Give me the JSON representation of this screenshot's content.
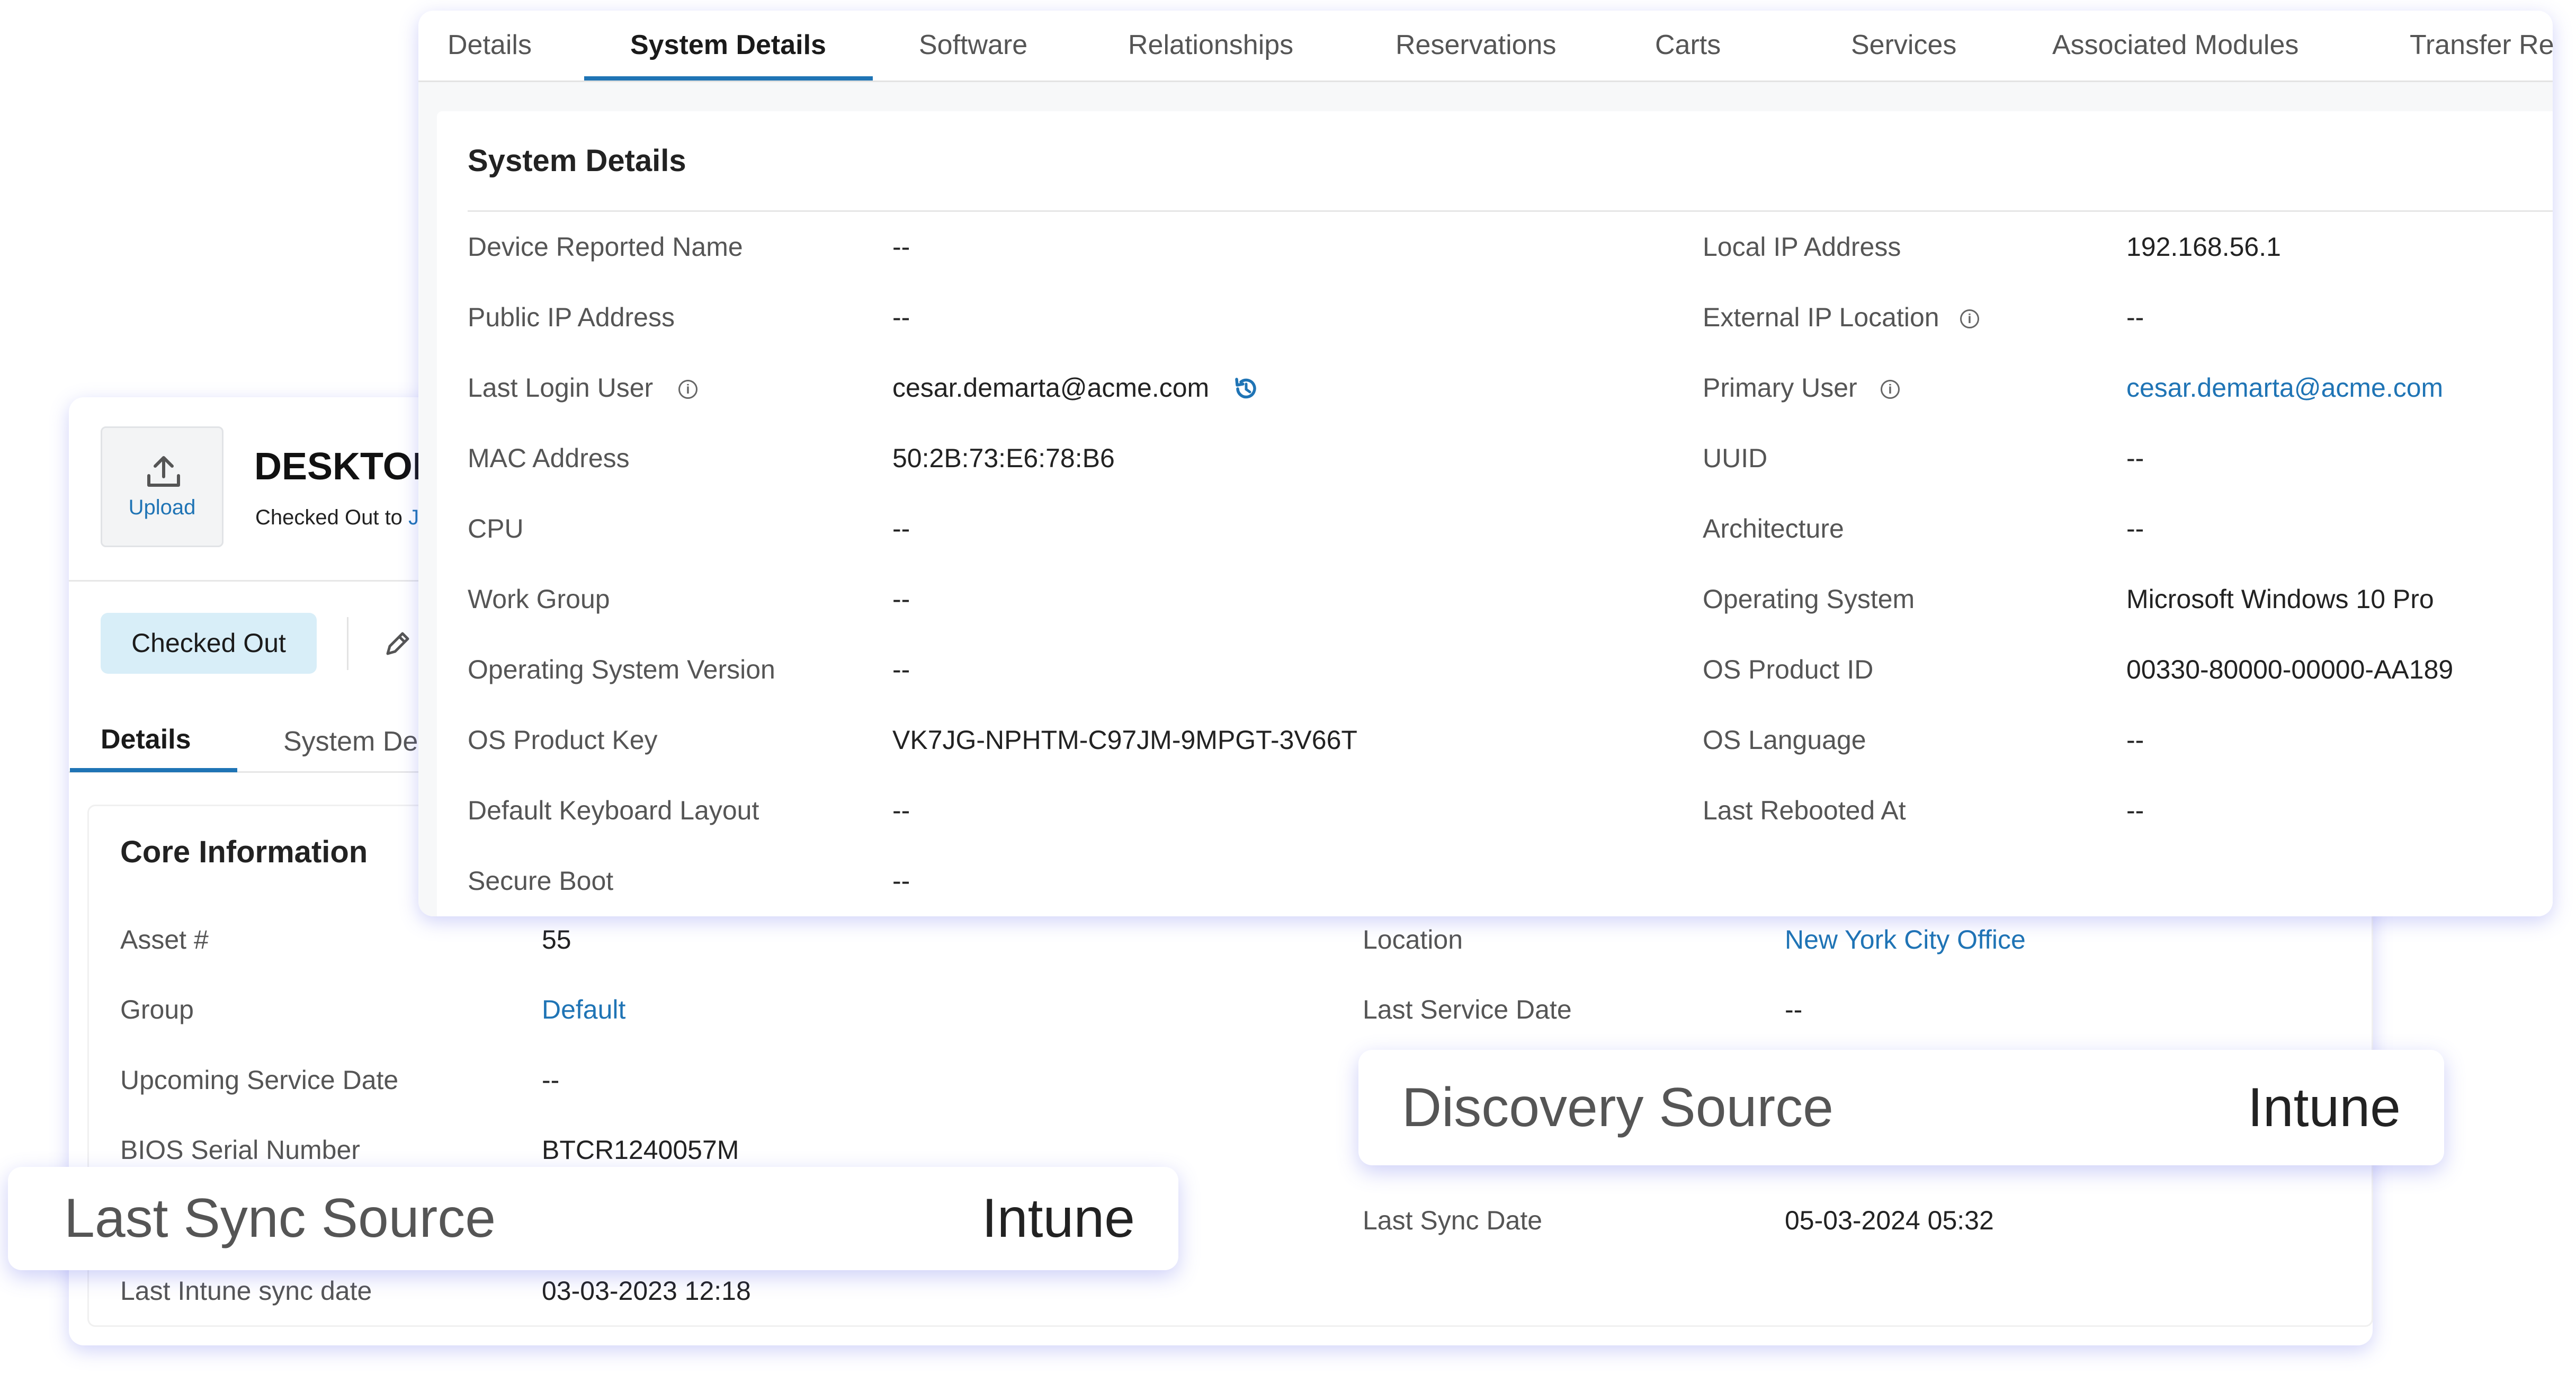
{
  "asset": {
    "upload_label": "Upload",
    "title": "DESKTOP",
    "checked_out_text": "Checked Out to",
    "checked_out_link": "J",
    "status_badge": "Checked Out",
    "tabs": [
      {
        "label": "Details"
      },
      {
        "label": "System De"
      }
    ],
    "core": {
      "title": "Core Information",
      "left_rows": [
        {
          "label": "Asset #",
          "value": "55"
        },
        {
          "label": "Group",
          "value": "Default"
        },
        {
          "label": "Upcoming Service Date",
          "value": "--"
        },
        {
          "label": "BIOS Serial Number",
          "value": "BTCR1240057M"
        },
        {
          "label": "Last Intune sync date",
          "value": "03-03-2023 12:18"
        }
      ],
      "right_rows": [
        {
          "label": "Location",
          "value": "New York City Office"
        },
        {
          "label": "Last Service Date",
          "value": "--"
        },
        {
          "label": "Last Sync Date",
          "value": "05-03-2024 05:32"
        }
      ]
    }
  },
  "system": {
    "tabs": [
      {
        "label": "Details"
      },
      {
        "label": "System Details"
      },
      {
        "label": "Software"
      },
      {
        "label": "Relationships"
      },
      {
        "label": "Reservations"
      },
      {
        "label": "Carts"
      },
      {
        "label": "Services"
      },
      {
        "label": "Associated Modules"
      },
      {
        "label": "Transfer Re"
      }
    ],
    "title": "System Details",
    "left_rows": [
      {
        "label": "Device Reported Name",
        "value": "--"
      },
      {
        "label": "Public IP Address",
        "value": "--"
      },
      {
        "label": "Last Login User",
        "value": "cesar.demarta@acme.com"
      },
      {
        "label": "MAC Address",
        "value": "50:2B:73:E6:78:B6"
      },
      {
        "label": "CPU",
        "value": "--"
      },
      {
        "label": "Work Group",
        "value": "--"
      },
      {
        "label": "Operating System Version",
        "value": "--"
      },
      {
        "label": "OS Product Key",
        "value": "VK7JG-NPHTM-C97JM-9MPGT-3V66T"
      },
      {
        "label": "Default Keyboard Layout",
        "value": "--"
      },
      {
        "label": "Secure Boot",
        "value": "--"
      }
    ],
    "right_rows": [
      {
        "label": "Local IP Address",
        "value": "192.168.56.1"
      },
      {
        "label": "External IP Location",
        "value": "--"
      },
      {
        "label": "Primary User",
        "value": "cesar.demarta@acme.com"
      },
      {
        "label": "UUID",
        "value": "--"
      },
      {
        "label": "Architecture",
        "value": "--"
      },
      {
        "label": "Operating System",
        "value": "Microsoft Windows 10 Pro"
      },
      {
        "label": "OS Product ID",
        "value": "00330-80000-00000-AA189"
      },
      {
        "label": "OS Language",
        "value": "--"
      },
      {
        "label": "Last Rebooted At",
        "value": "--"
      }
    ]
  },
  "callouts": {
    "last_sync": {
      "label": "Last Sync Source",
      "value": "Intune"
    },
    "discovery": {
      "label": "Discovery Source",
      "value": "Intune"
    }
  },
  "colors": {
    "accent": "#1f74b5",
    "badge_bg": "#d8eef8",
    "shadow": "#5860e8"
  },
  "icons": {
    "upload": "upload-icon",
    "edit": "pencil-icon",
    "info": "info-icon",
    "history": "history-icon"
  }
}
